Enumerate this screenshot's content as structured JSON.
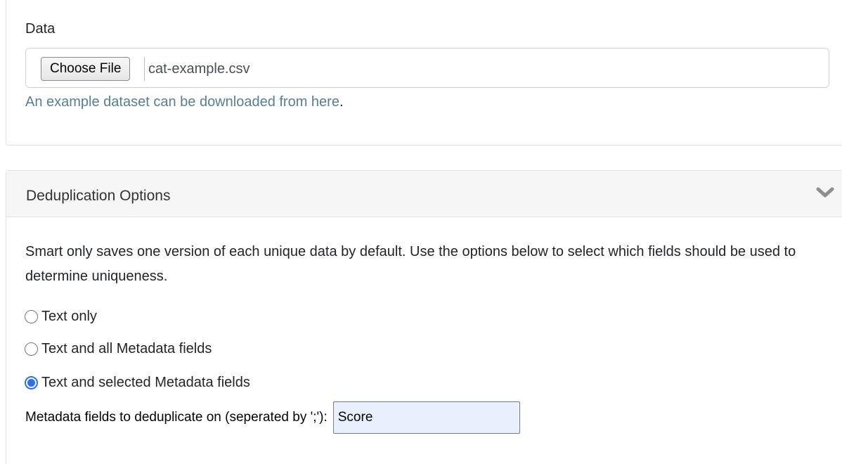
{
  "data_section": {
    "label": "Data",
    "choose_file_label": "Choose File",
    "file_name": "cat-example.csv",
    "example_link_text": "An example dataset can be downloaded from here",
    "example_suffix": "."
  },
  "dedup_section": {
    "title": "Deduplication Options",
    "description": "Smart only saves one version of each unique data by default. Use the options below to select which fields should be used to determine uniqueness.",
    "options": [
      {
        "label": "Text only",
        "checked": false
      },
      {
        "label": "Text and all Metadata fields",
        "checked": false
      },
      {
        "label": "Text and selected Metadata fields",
        "checked": true
      }
    ],
    "metadata_label": "Metadata fields to deduplicate on (seperated by ';'):",
    "metadata_value": "Score"
  },
  "icons": {
    "collapse": "chevron-down-icon"
  },
  "colors": {
    "link": "#5b7d91",
    "radio_checked": "#2f6fe8",
    "input_autofill_bg": "#e8f0fe",
    "header_bg": "#f6f6f6"
  }
}
